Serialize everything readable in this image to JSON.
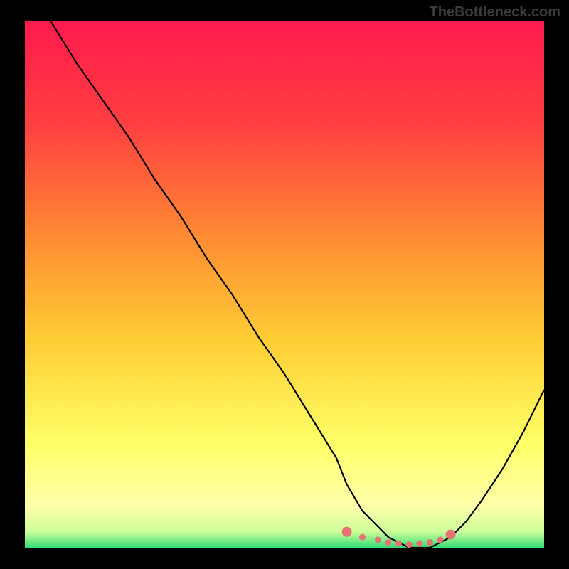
{
  "watermark": "TheBottleneck.com",
  "chart_data": {
    "type": "line",
    "title": "",
    "xlabel": "",
    "ylabel": "",
    "xlim": [
      0,
      100
    ],
    "ylim": [
      0,
      100
    ],
    "x": [
      5,
      10,
      15,
      20,
      25,
      30,
      35,
      40,
      45,
      50,
      55,
      60,
      62,
      65,
      68,
      70,
      72,
      74,
      76,
      78,
      80,
      82,
      85,
      88,
      92,
      96,
      100
    ],
    "values": [
      100,
      92,
      85,
      78,
      70,
      63,
      55,
      48,
      40,
      33,
      25,
      17,
      12,
      7,
      4,
      2,
      1,
      0,
      0,
      0,
      1,
      2,
      5,
      9,
      15,
      22,
      30
    ],
    "optimal_range": {
      "dots_x": [
        62,
        65,
        68,
        70,
        72,
        74,
        76,
        78,
        80,
        82
      ],
      "dots_y": [
        3,
        2,
        1.5,
        1,
        0.8,
        0.6,
        0.8,
        1,
        1.5,
        2.5
      ]
    },
    "gradient_stops": [
      {
        "pos": 0,
        "color": "#ff1a4d"
      },
      {
        "pos": 20,
        "color": "#ff4040"
      },
      {
        "pos": 40,
        "color": "#ff8833"
      },
      {
        "pos": 60,
        "color": "#ffcc33"
      },
      {
        "pos": 80,
        "color": "#ffff66"
      },
      {
        "pos": 92,
        "color": "#ffffaa"
      },
      {
        "pos": 97,
        "color": "#ccff99"
      },
      {
        "pos": 100,
        "color": "#33dd77"
      }
    ],
    "dot_color": "#e57373"
  }
}
